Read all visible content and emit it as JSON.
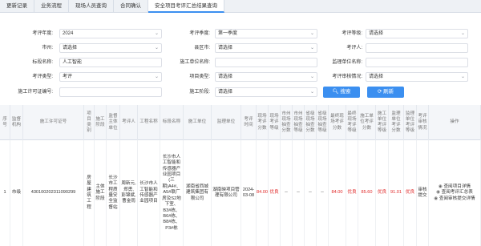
{
  "tabs": [
    {
      "label": "更新记录"
    },
    {
      "label": "业务流程"
    },
    {
      "label": "现场人员查询"
    },
    {
      "label": "合同确认"
    },
    {
      "label": "安全项目考评汇总结果查询"
    }
  ],
  "filters": {
    "year_label": "考评年度:",
    "year_value": "2024",
    "season_label": "考评季度:",
    "season_value": "第一季度",
    "level_label": "考评等级:",
    "level_value": "请选择",
    "city_label": "市州:",
    "city_value": "请选择",
    "county_label": "县区市:",
    "county_value": "请选择",
    "assessor_label": "考评人:",
    "assessor_value": "",
    "project_label": "标段名称:",
    "project_value": "人工智能",
    "construction_unit_label": "施工单位名称:",
    "construction_unit_value": "",
    "supervision_unit_label": "监理单位名称:",
    "supervision_unit_value": "",
    "assess_type_label": "考评类型:",
    "assess_type_value": "考评",
    "project_type_label": "项目类型:",
    "project_type_value": "请选择",
    "audit_label": "考评审核情况:",
    "audit_value": "请选择",
    "permit_label": "施工许可证编号:",
    "permit_value": "",
    "stage_label": "施工阶段:",
    "stage_value": "请选择"
  },
  "buttons": {
    "search": "搜索",
    "refresh": "刷新"
  },
  "table": {
    "headers": [
      "序号",
      "监督机构",
      "施工许可证号",
      "项目类别",
      "施工阶段",
      "监督主体单位",
      "考评人",
      "工程名称",
      "标段名称",
      "施工单位",
      "监理单位",
      "考评时间",
      "现场考评分数",
      "现场考评等级",
      "市州现场抽查分数",
      "市州现场抽查等级",
      "省级现场抽查分数",
      "省级现场抽查等级",
      "最终现场考评分数",
      "最终现场考评等级",
      "施工单位考评分数",
      "施工单位考评等级",
      "监理单位考评分数",
      "监理单位考评等级",
      "考评审核情况",
      "操作"
    ],
    "row": {
      "index": "1",
      "agency": "市级",
      "permit": "430100202311090299",
      "category": "房屋建筑工程",
      "stage": "主体施工阶段",
      "supervisor": "长沙市工程质量安全监督站",
      "assessor": "周新元, 郑勇, 彭锦斌, 曹金雨",
      "project_name": "长沙市人工智能和传感器产业园项目",
      "section_name": "长沙市人工智能和传感器产业园项目(三期)A4#、A5#联厂房及S2地下室、B3#栋、B6#栋、B8#栋、P3#栋",
      "construction_unit": "湖南省西城建筑集团有限公司",
      "supervision_unit": "湖南映项目管理有限公司",
      "time": "2024-03-08",
      "site_score": "84.00",
      "site_level": "优良",
      "city_score": "--",
      "city_level": "--",
      "prov_score": "--",
      "prov_level": "--",
      "final_score": "84.00",
      "final_level": "优良",
      "cons_score": "85.60",
      "cons_level": "优良",
      "sup_score": "91.01",
      "sup_level": "优良",
      "audit": "审核提交",
      "op1": "查阅项目详情",
      "op2": "查阅考评汇总表",
      "op3": "查阅审核提交详情"
    }
  },
  "colors": {
    "accent": "#3b8ff0",
    "danger": "#e02828"
  }
}
